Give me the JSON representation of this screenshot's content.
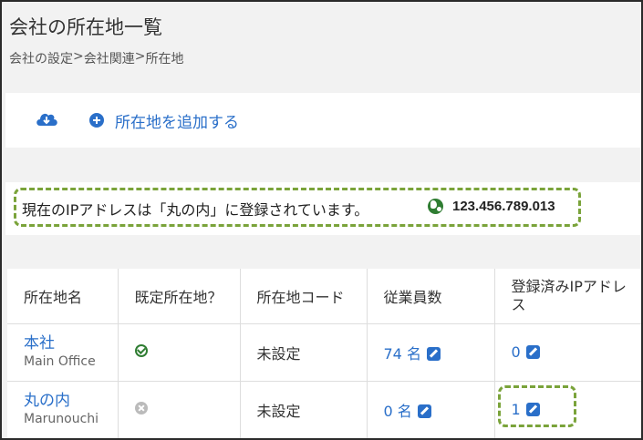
{
  "page": {
    "title": "会社の所在地一覧",
    "breadcrumb": [
      "会社の設定",
      " > ",
      "会社関連",
      " > ",
      "所在地"
    ]
  },
  "toolbar": {
    "download_icon": "cloud-download-icon",
    "add_icon": "plus-circle-icon",
    "add_label": "所在地を追加する"
  },
  "ip_notice": {
    "text": "現在のIPアドレスは「丸の内」に登録されています。",
    "ip": "123.456.789.013",
    "icon": "globe-icon"
  },
  "table": {
    "headers": [
      "所在地名",
      "既定所在地？",
      "所在地コード",
      "従業員数",
      "登録済みIPアドレス"
    ],
    "rows": [
      {
        "name": "本社",
        "sub": "Main Office",
        "default": true,
        "code": "未設定",
        "employees": "74 名",
        "ips": "0"
      },
      {
        "name": "丸の内",
        "sub": "Marunouchi",
        "default": false,
        "code": "未設定",
        "employees": "0 名",
        "ips": "1"
      }
    ]
  },
  "colors": {
    "accent": "#2a6fc9",
    "highlight": "#7aa33a",
    "success": "#2f7d32"
  }
}
